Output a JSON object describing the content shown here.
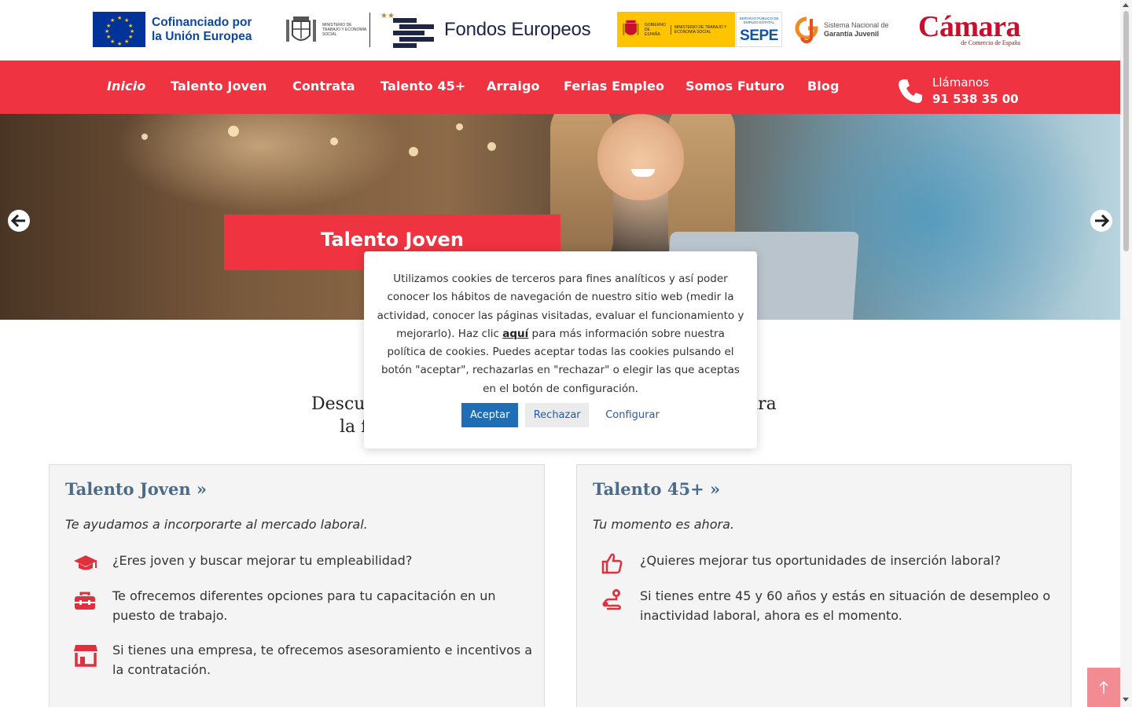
{
  "logos": {
    "eu": "Cofinanciado por la Unión Europea",
    "eu_line1": "Cofinanciado por",
    "eu_line2": "la Unión Europea",
    "ministerio": "MINISTERIO DE TRABAJO Y ECONOMÍA SOCIAL",
    "fondos": "Fondos Europeos",
    "gobierno": "GOBIERNO DE ESPAÑA",
    "gobierno_ministerio": "MINISTERIO DE TRABAJO Y ECONOMÍA SOCIAL",
    "sepe_small": "SERVICIO PÚBLICO DE EMPLEO ESTATAL",
    "sepe": "SEPE",
    "sngj_line1": "Sistema Nacional de",
    "sngj_line2": "Garantía Juvenil",
    "camara": "Cámara",
    "camara_sub": "de Comercio de España"
  },
  "nav": {
    "items": [
      {
        "label": "Inicio",
        "active": true
      },
      {
        "label": "Talento Joven"
      },
      {
        "label": "Contrata"
      },
      {
        "label": "Talento 45+"
      },
      {
        "label": "Arraigo"
      },
      {
        "label": "Ferias Empleo"
      },
      {
        "label": "Somos Futuro"
      },
      {
        "label": "Blog"
      }
    ],
    "phone_label": "Llámanos",
    "phone_number": "91 538 35 00"
  },
  "hero": {
    "banner": "Talento Joven",
    "prev_icon": "arrow-left-icon",
    "next_icon": "arrow-right-icon"
  },
  "intro": {
    "line1_start": "Descu",
    "line1_end": "ara",
    "line2_start": "la f"
  },
  "cookie": {
    "text_before": "Utilizamos cookies de terceros para fines analíticos y así poder conocer los hábitos de navegación de nuestro sitio web (medir la actividad, conocer las páginas visitadas, evaluar el funcionamiento y mejorarlo). Haz clic ",
    "link": "aquí",
    "text_after": " para más información sobre nuestra política de cookies. Puedes aceptar todas las cookies pulsando el botón \"aceptar\", rechazarlas en \"rechazar\" o elegir las que aceptas en el botón de configuración.",
    "accept": "Aceptar",
    "reject": "Rechazar",
    "configure": "Configurar"
  },
  "cards": [
    {
      "title": "Talento Joven »",
      "subtitle": "Te ayudamos a incorporarte al mercado laboral.",
      "items": [
        {
          "icon": "graduation-cap-icon",
          "text": "¿Eres joven y buscar mejorar tu empleabilidad?"
        },
        {
          "icon": "toolbox-icon",
          "text": "Te ofrecemos diferentes opciones para tu capacitación en un puesto de trabajo."
        },
        {
          "icon": "store-icon",
          "text": "Si tienes una empresa, te ofrecemos asesoramiento e incentivos a la contratación."
        }
      ]
    },
    {
      "title": "Talento 45+ »",
      "subtitle": "Tu momento es ahora.",
      "items": [
        {
          "icon": "thumbs-up-icon",
          "text": "¿Quieres mejorar tus oportunidades de inserción laboral?"
        },
        {
          "icon": "route-icon",
          "text": "Si tienes entre 45 y 60 años y estás en situación de desempleo o inactividad laboral, ahora es el momento."
        }
      ]
    }
  ],
  "back_to_top_icon": "arrow-up-icon",
  "colors": {
    "brand_red": "#ef3340",
    "link_blue": "#1f6db5",
    "card_title": "#4a6b8a",
    "card_bg": "#f4f4f4"
  }
}
